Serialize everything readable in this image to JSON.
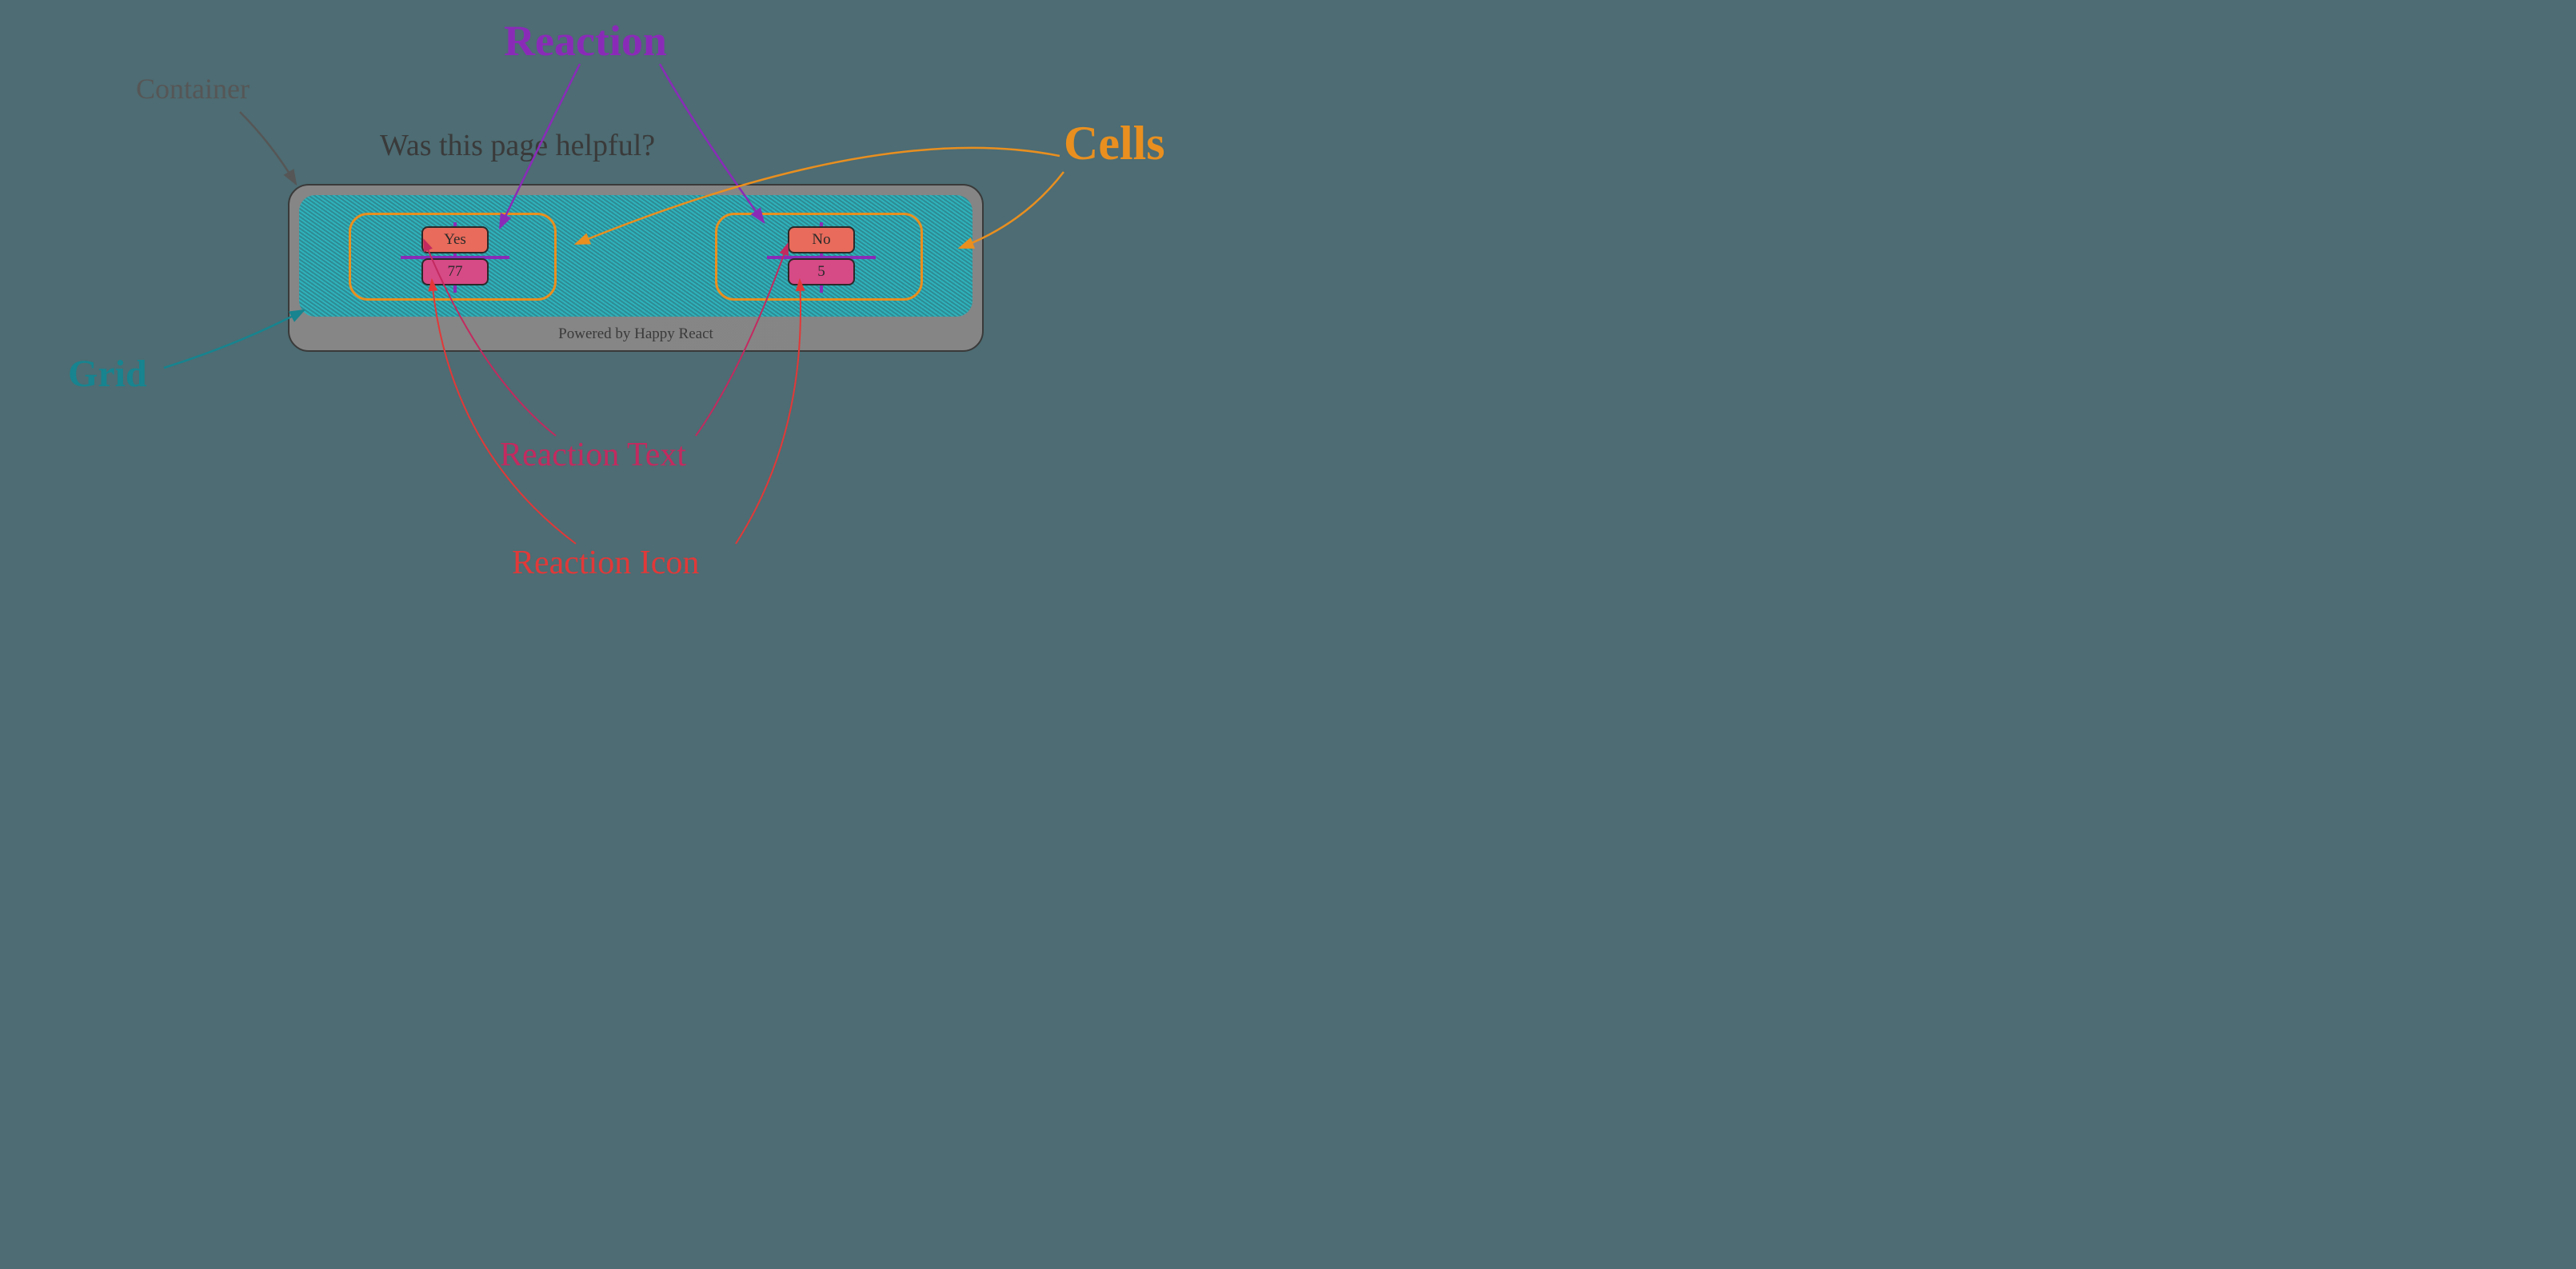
{
  "labels": {
    "container": "Container",
    "reaction": "Reaction",
    "cells": "Cells",
    "grid": "Grid",
    "reactionText": "Reaction Text",
    "reactionIcon": "Reaction Icon"
  },
  "widget": {
    "title": "Was this page helpful?",
    "footer": "Powered by Happy React",
    "cells": [
      {
        "label": "Yes",
        "count": "77"
      },
      {
        "label": "No",
        "count": "5"
      }
    ]
  },
  "colors": {
    "container": "#565656",
    "reaction": "#8a2bb8",
    "cells": "#e98f1f",
    "grid": "#17848f",
    "reactionText": "#c32a5f",
    "reactionIcon": "#e23838"
  }
}
